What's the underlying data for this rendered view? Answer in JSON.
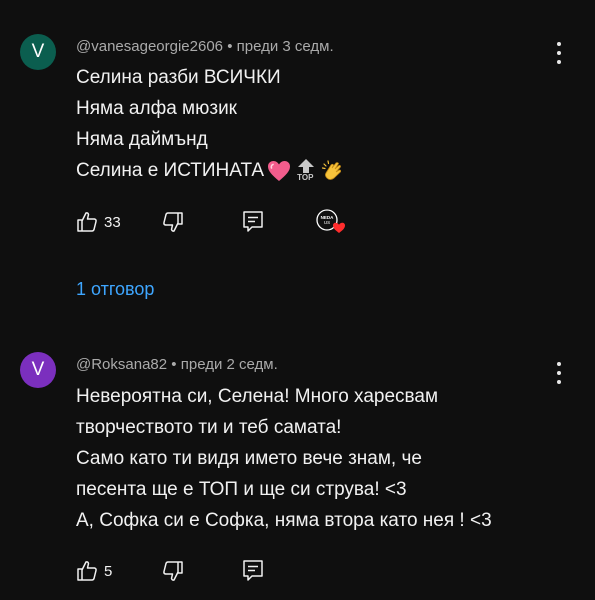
{
  "comments": [
    {
      "avatar_letter": "V",
      "avatar_color": "#0b5e4f",
      "author": "@vanesageorgie2606",
      "time": "преди 3 седм.",
      "lines": [
        "Селина разби ВСИЧКИ",
        "Няма алфа мюзик",
        "Няма даймънд",
        "Селина е ИСТИНАТА"
      ],
      "emojis": [
        "heart-emoji",
        "top-arrow-emoji",
        "clapping-hands-emoji"
      ],
      "top_label": "TOP",
      "likes": "33",
      "creator_heart_label": "NEDA\nUS",
      "replies_label": "1 отговор"
    },
    {
      "avatar_letter": "V",
      "avatar_color": "#7b2fbe",
      "author": "@Roksana82",
      "time": "преди 2 седм.",
      "lines": [
        "Невероятна си, Селена! Много харесвам",
        "творчеството ти и теб самата!",
        "Само като ти видя името вече знам, че",
        "песента ще е ТОП и ще си струва! <3",
        "А, Софка си е Софка, няма втора като нея ! <3"
      ],
      "likes": "5"
    }
  ],
  "separator": "•"
}
